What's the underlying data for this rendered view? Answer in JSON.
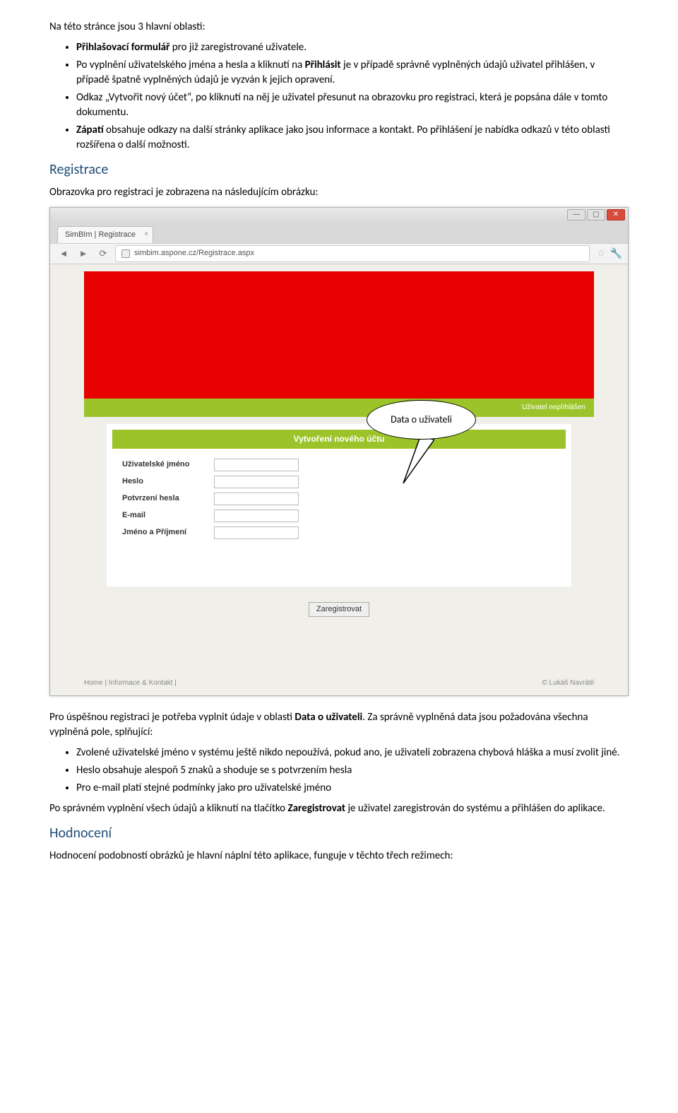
{
  "doc": {
    "intro_line": "Na této stránce jsou 3 hlavní oblasti:",
    "bullets1": {
      "b1_prefix": "Přihlašovací formulář",
      "b1_rest": " pro již zaregistrované uživatele.",
      "b2_a": "Po vyplnění uživatelského jména a hesla  a kliknutí na ",
      "b2_bold": "Přihlásit",
      "b2_b": " je v případě správně vyplněných údajů uživatel přihlášen, v případě špatně vyplněných údajů je vyzván k jejich opravení.",
      "b3": "Odkaz „Vytvořit nový účet“, po kliknutí na něj je uživatel přesunut na obrazovku pro registraci, která je popsána dále v tomto dokumentu.",
      "b4_bold": "Zápatí",
      "b4_rest": " obsahuje odkazy na další stránky aplikace jako jsou informace a kontakt. Po přihlášení je nabídka odkazů v této oblasti rozšířena o další možnosti."
    },
    "h_registrace": "Registrace",
    "registrace_line": "Obrazovka pro registraci je zobrazena na následujícím obrázku:",
    "after1_a": "Pro úspěšnou registraci je potřeba vyplnit údaje v oblasti ",
    "after1_bold": "Data o uživateli",
    "after1_b": ". Za správně vyplněná data jsou požadována všechna vyplněná pole, splňující:",
    "bullets2": {
      "b1": "Zvolené uživatelské jméno v systému ještě nikdo nepoužívá, pokud ano, je uživateli zobrazena chybová hláška a musí zvolit jiné.",
      "b2": "Heslo obsahuje alespoň 5 znaků a shoduje se s potvrzením hesla",
      "b3": "Pro e-mail platí stejné podmínky jako pro uživatelské jméno"
    },
    "after2_a": "Po správném vyplnění všech údajů a kliknutí na tlačítko ",
    "after2_bold": "Zaregistrovat",
    "after2_b": " je uživatel zaregistrován do systému a přihlášen do aplikace.",
    "h_hodnoceni": "Hodnocení",
    "hodnoceni_line": "Hodnocení podobností obrázků je hlavní náplní této aplikace, funguje v těchto třech režimech:"
  },
  "browser": {
    "tab_title": "SimBIm | Registrace",
    "url": "simbim.aspone.cz/Registrace.aspx",
    "login_status": "Uživatel nepřihlášen",
    "card_title": "Vytvoření nového účtu",
    "fields": {
      "username": "Uživatelské jméno",
      "password": "Heslo",
      "confirm": "Potvrzení hesla",
      "email": "E-mail",
      "fullname": "Jméno a Příjmení"
    },
    "submit": "Zaregistrovat",
    "footer_left": "Home  |  Informace & Kontakt  |",
    "footer_right": "© Lukáš Navrátil"
  },
  "callout": {
    "text": "Data o uživateli"
  }
}
